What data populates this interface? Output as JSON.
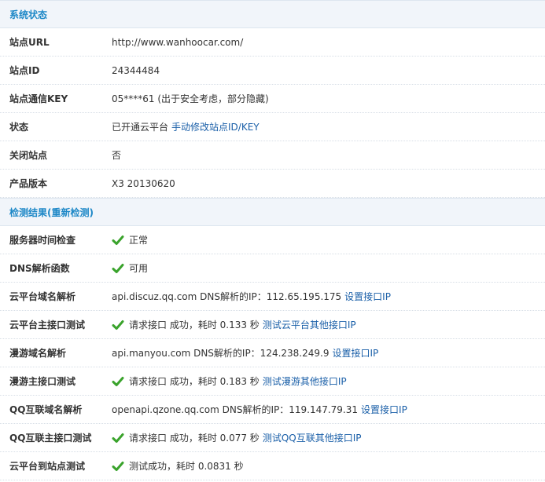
{
  "sections": {
    "status_title": "系统状态",
    "result_title": "检测结果(重新检测)"
  },
  "status_rows": [
    {
      "label": "站点URL",
      "value": "http://www.wanhoocar.com/"
    },
    {
      "label": "站点ID",
      "value": "24344484"
    },
    {
      "label": "站点通信KEY",
      "value": "05****61 (出于安全考虑，部分隐藏)"
    },
    {
      "label": "状态",
      "value": "已开通云平台",
      "link": "手动修改站点ID/KEY"
    },
    {
      "label": "关闭站点",
      "value": "否"
    },
    {
      "label": "产品版本",
      "value": "X3 20130620"
    }
  ],
  "check_rows": [
    {
      "label": "服务器时间检查",
      "value": "正常"
    },
    {
      "label": "DNS解析函数",
      "value": "可用"
    },
    {
      "label": "云平台域名解析",
      "value": "api.discuz.qq.com DNS解析的IP：112.65.195.175",
      "link": "设置接口IP"
    },
    {
      "label": "云平台主接口测试",
      "value": "请求接口 成功，耗时 0.133 秒",
      "link": "测试云平台其他接口IP"
    },
    {
      "label": "漫游域名解析",
      "value": "api.manyou.com DNS解析的IP：124.238.249.9",
      "link": "设置接口IP"
    },
    {
      "label": "漫游主接口测试",
      "value": "请求接口 成功，耗时 0.183 秒",
      "link": "测试漫游其他接口IP"
    },
    {
      "label": "QQ互联域名解析",
      "value": "openapi.qzone.qq.com DNS解析的IP：119.147.79.31",
      "link": "设置接口IP"
    },
    {
      "label": "QQ互联主接口测试",
      "value": "请求接口 成功，耗时 0.077 秒",
      "link": "测试QQ互联其他接口IP"
    },
    {
      "label": "云平台到站点测试",
      "value": "测试成功，耗时 0.0831 秒"
    }
  ],
  "colors": {
    "header_text": "#1e88c7",
    "link": "#1a5fa8",
    "check": "#3aa32c",
    "header_bg": "#f1f5fa"
  },
  "icons": {
    "check": "check-icon"
  }
}
